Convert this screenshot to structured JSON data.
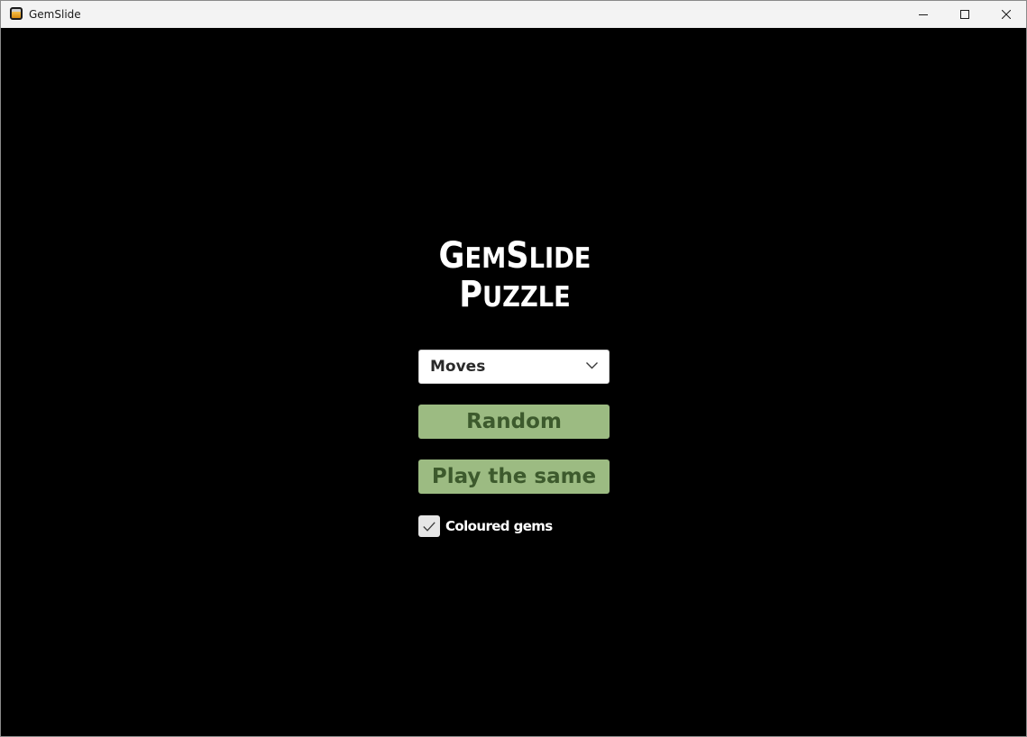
{
  "window": {
    "title": "GemSlide",
    "icon": "gemslide-app-icon",
    "controls": {
      "minimize": "minimize-icon",
      "maximize": "maximize-icon",
      "close": "close-icon"
    }
  },
  "logo": {
    "line1_big1": "G",
    "line1_small1": "EM",
    "line1_big2": "S",
    "line1_small2": "LIDE",
    "line2_big": "P",
    "line2_small": "UZZLE"
  },
  "mode_select": {
    "selected": "Moves",
    "icon": "chevron-down-icon"
  },
  "buttons": {
    "random": "Random",
    "play_same": "Play the same"
  },
  "coloured_gems": {
    "label": "Coloured gems",
    "checked": true,
    "icon": "checkmark-icon"
  },
  "colors": {
    "background": "#000000",
    "button_bg": "#9cbb82",
    "button_text": "#3d5a2d",
    "logo_text": "#ffffff"
  }
}
